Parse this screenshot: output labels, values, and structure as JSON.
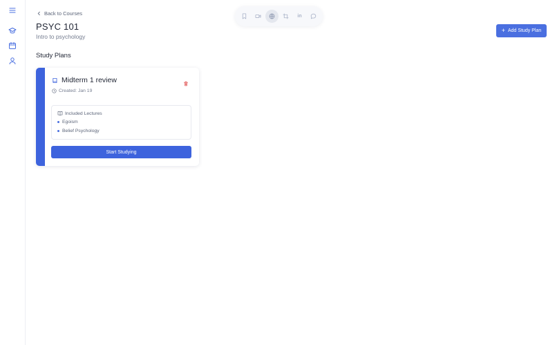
{
  "sidebar": {
    "items": [
      {
        "icon": "menu-icon"
      },
      {
        "icon": "graduation-cap-icon"
      },
      {
        "icon": "calendar-icon"
      },
      {
        "icon": "user-icon"
      }
    ]
  },
  "toolbar": {
    "items": [
      {
        "icon": "bookmark-icon"
      },
      {
        "icon": "video-icon"
      },
      {
        "icon": "globe-icon",
        "active": true
      },
      {
        "icon": "crop-icon"
      },
      {
        "icon": "linkedin-icon",
        "text": "in"
      },
      {
        "icon": "chat-bubble-icon"
      }
    ]
  },
  "header": {
    "back_label": "Back to Courses",
    "title": "PSYC 101",
    "subtitle": "Intro to psychology",
    "add_button_label": "Add Study Plan"
  },
  "section_title": "Study Plans",
  "study_plan": {
    "title": "Midterm 1 review",
    "created": "Created: Jan 19",
    "lectures_heading": "Included Lectures",
    "lectures": [
      "Egoism",
      "Belief Psychology"
    ],
    "start_button_label": "Start Studying"
  },
  "colors": {
    "accent": "#3d63dd",
    "button": "#4a6fe0",
    "delete": "#e05252"
  }
}
